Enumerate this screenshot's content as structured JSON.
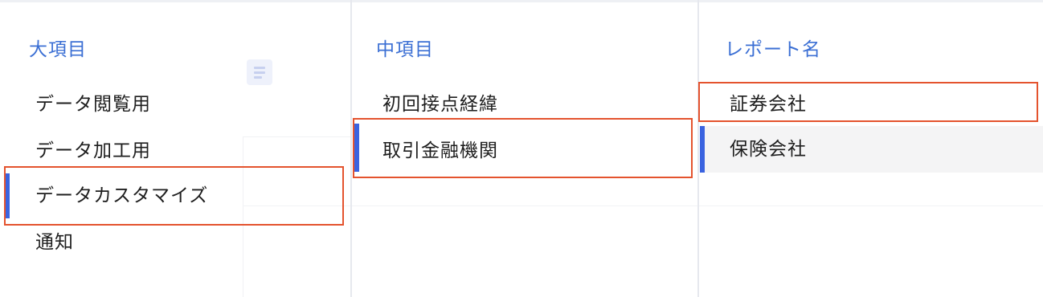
{
  "columns": {
    "major": {
      "header": "大項目",
      "items": [
        {
          "label": "データ閲覧用"
        },
        {
          "label": "データ加工用"
        },
        {
          "label": "データカスタマイズ"
        },
        {
          "label": "通知"
        }
      ],
      "selected": "データカスタマイズ"
    },
    "middle": {
      "header": "中項目",
      "items": [
        {
          "label": "初回接点経緯"
        },
        {
          "label": "取引金融機関"
        }
      ],
      "selected": "取引金融機関"
    },
    "report": {
      "header": "レポート名",
      "items": [
        {
          "label": "証券会社"
        },
        {
          "label": "保険会社"
        }
      ],
      "selected": "保険会社"
    }
  },
  "colors": {
    "header_text": "#3b6fd4",
    "active_bar": "#3a63e0",
    "highlight_box": "#e4532e",
    "selected_background": "#f4f4f5"
  },
  "icons": {
    "floating_doc": "document-icon"
  }
}
